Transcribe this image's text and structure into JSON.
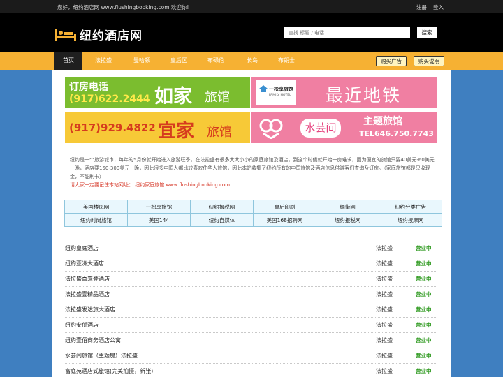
{
  "topbar": {
    "greeting": "您好，纽约酒店网 www.flushingbooking.com 欢迎你!",
    "register": "注册",
    "login": "登入"
  },
  "header": {
    "logo_text": "纽约酒店网",
    "search_placeholder": "查找 标题 / 电话",
    "search_button": "搜索"
  },
  "nav": {
    "items": [
      "首页",
      "法拉盛",
      "曼哈顿",
      "皇后区",
      "布碌伦",
      "长岛",
      "布朗士"
    ],
    "active": "首页",
    "buy_ad": "购买广告",
    "buy_info": "购买说明"
  },
  "banners": [
    {
      "line1": "订房电话",
      "line2": "(917)622.2444",
      "big": "如家",
      "small": "旅馆",
      "bg": "#7bbd2f"
    },
    {
      "logo": "一松享旅馆",
      "logo_sub": "FAMILY HOTEL",
      "text": "最近地铁",
      "bg": "#f07fa2"
    },
    {
      "line2": "(917)929.4822",
      "big": "宜家",
      "small": "旅馆",
      "bg": "#f7c937"
    },
    {
      "brand": "水芸间",
      "title": "主题旅馆",
      "tel": "TEL646.750.7743",
      "bg": "#f07fa2"
    }
  ],
  "description": {
    "text": "纽约是一个旅游城市，每年的5月份就开始进入旅游旺季，在法拉盛有很多大大小小的家庭旅馆及酒店，到这个时候就开始一房难求，因为便宜的旅馆只要40美元-60美元一晚，酒店要150-300美元一晚，因此很多中国人都比较喜欢住华人旅馆，因此本站收集了纽约所有的中国旅馆及酒店信息供游客们查询及订房。（家庭旅馆都是只收现金，不能刷卡）",
    "remember": "请大家一定要记住本站网址： 纽约家庭旅馆 www.flushingbooking.com"
  },
  "links": [
    [
      "美国楼凤网",
      "一松享旅馆",
      "纽约报税网",
      "皇后印刷",
      "缅街网",
      "纽约分类广告"
    ],
    [
      "纽约时尚旅馆",
      "美国144",
      "纽约自媒体",
      "美国168招聘网",
      "纽约报税网",
      "纽约按摩网"
    ]
  ],
  "hotels": [
    {
      "name": "纽约皇庭酒店",
      "area": "法拉盛",
      "status": "营业中"
    },
    {
      "name": "纽约亚洲大酒店",
      "area": "法拉盛",
      "status": "营业中"
    },
    {
      "name": "法拉盛喜来登酒店",
      "area": "法拉盛",
      "status": "营业中"
    },
    {
      "name": "法拉盛壹精品酒店",
      "area": "法拉盛",
      "status": "营业中"
    },
    {
      "name": "法拉盛发达旅大酒店",
      "area": "法拉盛",
      "status": "营业中"
    },
    {
      "name": "纽约安侨酒店",
      "area": "法拉盛",
      "status": "营业中"
    },
    {
      "name": "纽约壹佰商务酒店公寓",
      "area": "法拉盛",
      "status": "营业中"
    },
    {
      "name": "水芸间旅馆（主题房）法拉盛",
      "area": "法拉盛",
      "status": "营业中"
    },
    {
      "name": "富庭苑酒店式旅馆(完美拍摄，新张)",
      "area": "法拉盛",
      "status": "营业中"
    }
  ],
  "colors": {
    "nav": "#f6b133",
    "background": "#3f7fc0",
    "status": "#2f9a20"
  }
}
